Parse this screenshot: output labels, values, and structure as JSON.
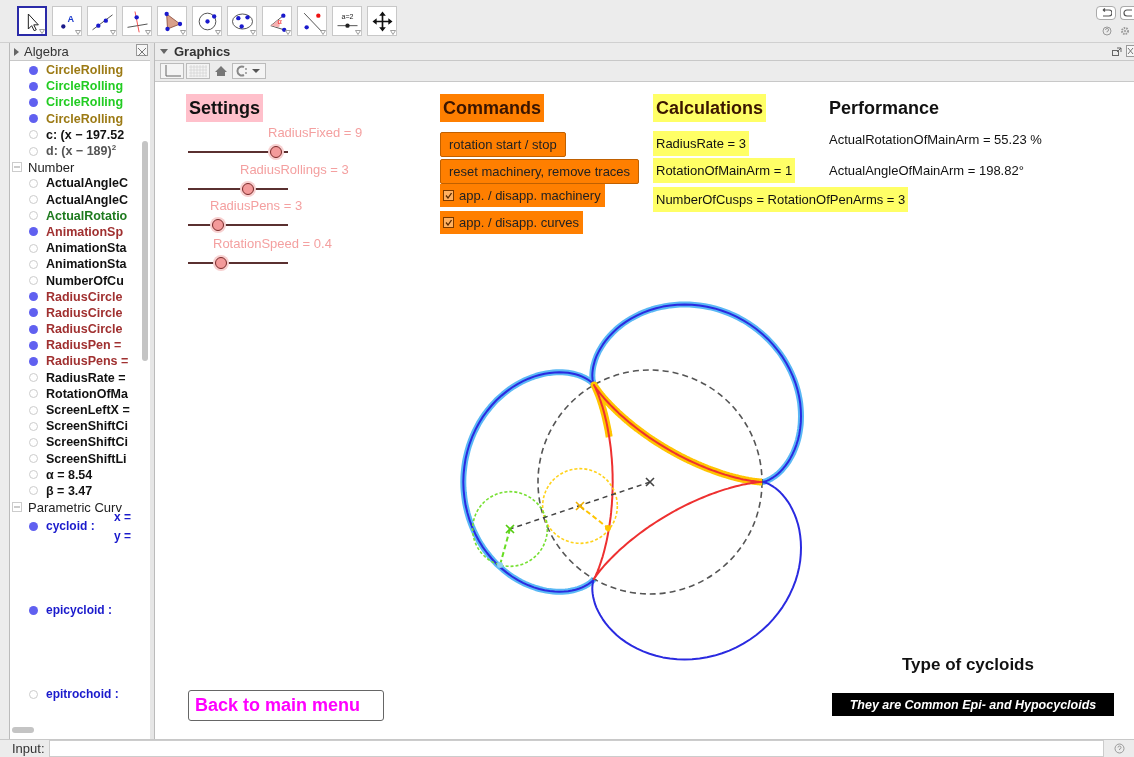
{
  "toolbar": {
    "tools": [
      {
        "kind": "move",
        "selected": true
      },
      {
        "kind": "point",
        "label": "A",
        "selected": false
      },
      {
        "kind": "line",
        "selected": false
      },
      {
        "kind": "perpendicular",
        "selected": false
      },
      {
        "kind": "polygon",
        "selected": false
      },
      {
        "kind": "circle",
        "selected": false
      },
      {
        "kind": "conic",
        "selected": false
      },
      {
        "kind": "angle",
        "label": "α",
        "selected": false
      },
      {
        "kind": "reflect",
        "selected": false
      },
      {
        "kind": "slider",
        "label": "a=2",
        "selected": false
      },
      {
        "kind": "move-view",
        "selected": false
      }
    ]
  },
  "algebra": {
    "title": "Algebra",
    "items": [
      {
        "kind": "value",
        "text": "CircleRolling",
        "visible": true,
        "color": "#9c7a14"
      },
      {
        "kind": "value",
        "text": "CircleRolling",
        "visible": true,
        "color": "#22cc22"
      },
      {
        "kind": "value",
        "text": "CircleRolling",
        "visible": true,
        "color": "#22cc22"
      },
      {
        "kind": "value",
        "text": "CircleRolling",
        "visible": true,
        "color": "#9c7a14"
      },
      {
        "kind": "value",
        "text": "c: (x − 197.52",
        "visible": false,
        "color": "#111111"
      },
      {
        "kind": "value",
        "text": "d: (x − 189)$^{2}$",
        "visible": false,
        "color": "#555555"
      }
    ],
    "groups": [
      {
        "label": "Number",
        "expanded": true,
        "items": [
          {
            "kind": "value",
            "text": "ActualAngleC",
            "visible": false,
            "color": "#111111"
          },
          {
            "kind": "value",
            "text": "ActualAngleC",
            "visible": false,
            "color": "#111111"
          },
          {
            "kind": "value",
            "text": "ActualRotatio",
            "visible": false,
            "color": "#1e7a1e"
          },
          {
            "kind": "value",
            "text": "AnimationSp",
            "visible": true,
            "color": "#a03030"
          },
          {
            "kind": "value",
            "text": "AnimationSta",
            "visible": false,
            "color": "#111111"
          },
          {
            "kind": "value",
            "text": "AnimationSta",
            "visible": false,
            "color": "#111111"
          },
          {
            "kind": "value",
            "text": "NumberOfCu",
            "visible": false,
            "color": "#111111"
          },
          {
            "kind": "value",
            "text": "RadiusCircle",
            "visible": true,
            "color": "#a03030"
          },
          {
            "kind": "value",
            "text": "RadiusCircle",
            "visible": true,
            "color": "#a03030"
          },
          {
            "kind": "value",
            "text": "RadiusCircle",
            "visible": true,
            "color": "#a03030"
          },
          {
            "kind": "value",
            "text": "RadiusPen =",
            "visible": true,
            "color": "#a03030"
          },
          {
            "kind": "value",
            "text": "RadiusPens =",
            "visible": true,
            "color": "#a03030"
          },
          {
            "kind": "value",
            "text": "RadiusRate =",
            "visible": false,
            "color": "#111111"
          },
          {
            "kind": "value",
            "text": "RotationOfMa",
            "visible": false,
            "color": "#111111"
          },
          {
            "kind": "value",
            "text": "ScreenLeftX =",
            "visible": false,
            "color": "#111111"
          },
          {
            "kind": "value",
            "text": "ScreenShiftCi",
            "visible": false,
            "color": "#111111"
          },
          {
            "kind": "value",
            "text": "ScreenShiftCi",
            "visible": false,
            "color": "#111111"
          },
          {
            "kind": "value",
            "text": "ScreenShiftLi",
            "visible": false,
            "color": "#111111"
          },
          {
            "kind": "value",
            "text": "α = 8.54",
            "visible": false,
            "color": "#111111"
          },
          {
            "kind": "value",
            "text": "β = 3.47",
            "visible": false,
            "color": "#111111"
          }
        ]
      },
      {
        "label": "Parametric Curv",
        "expanded": true,
        "items": [
          {
            "kind": "parametric",
            "text": "cycloid :",
            "visible": true,
            "color": "#1a1acc",
            "lines": [
              "x =",
              "y ="
            ]
          },
          {
            "kind": "parametric",
            "text": "epicycloid :",
            "visible": true,
            "color": "#1a1acc"
          },
          {
            "kind": "parametric",
            "text": "epitrochoid :",
            "visible": false,
            "color": "#1a1acc"
          }
        ]
      }
    ]
  },
  "graphics": {
    "title": "Graphics",
    "style_bar": {
      "axes_on": false,
      "grid_on": false
    },
    "settings": {
      "heading": "Settings",
      "sliders": [
        {
          "label": "RadiusFixed = 9",
          "level": 0.88
        },
        {
          "label": "RadiusRollings = 3",
          "level": 0.6
        },
        {
          "label": "RadiusPens = 3",
          "level": 0.3
        },
        {
          "label": "RotationSpeed = 0.4",
          "level": 0.33
        }
      ]
    },
    "commands": {
      "heading": "Commands",
      "controls": [
        {
          "kind": "button",
          "label": "rotation start / stop"
        },
        {
          "kind": "button",
          "label": "reset machinery, remove traces"
        },
        {
          "kind": "checkbox",
          "label": "app. / disapp. machinery",
          "checked": true
        },
        {
          "kind": "checkbox",
          "label": "app. / disapp. curves",
          "checked": true
        }
      ]
    },
    "calculations": {
      "heading": "Calculations",
      "items": [
        "RadiusRate = 3",
        "RotationOfMainArm = 1",
        "NumberOfCusps = RotationOfPenArms = 3"
      ]
    },
    "performance": {
      "heading": "Performance",
      "items": [
        "ActualRotationOfMainArm = 55.23 %",
        "ActualAngleOfMainArm = 198.82°"
      ]
    },
    "type_heading": "Type of cycloids",
    "type_caption": "They are Common Epi- and Hypocycloids",
    "back_button": "Back to main menu"
  },
  "input_bar": {
    "label": "Input:"
  }
}
